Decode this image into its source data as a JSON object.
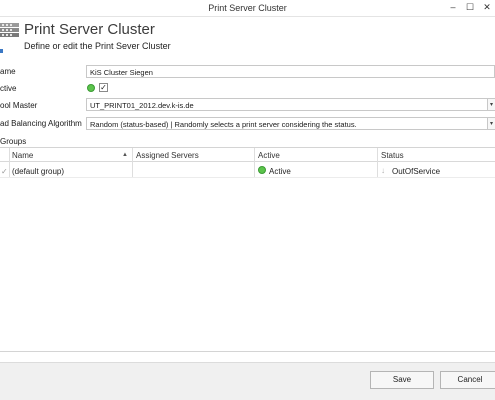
{
  "window": {
    "title": "Print Server Cluster",
    "minimize_glyph": "–",
    "maximize_glyph": "☐",
    "close_glyph": "✕"
  },
  "header": {
    "title": "Print Server Cluster",
    "subtitle": "Define or edit the Print Sever Cluster",
    "icon": "server-cluster-icon"
  },
  "form": {
    "name_label": "ame",
    "name_value": "KiS Cluster Siegen",
    "active_label": "ctive",
    "active_checked": "✓",
    "pool_master_label": "ool Master",
    "pool_master_value": "UT_PRINT01_2012.dev.k-is.de",
    "load_balancing_label": "ad Balancing Algorithm",
    "load_balancing_value": "Random (status-based) | Randomly selects a print server considering the status.",
    "dropdown_glyph": "▾"
  },
  "groups": {
    "section_label": "Groups",
    "columns": [
      "Name",
      "Assigned Servers",
      "Active",
      "Status"
    ],
    "sort_glyph": "▲",
    "rows": [
      {
        "name": "(default group)",
        "assigned_servers": "",
        "active": "Active",
        "status": "OutOfService"
      }
    ],
    "row_check_glyph": "✓",
    "status_arrow_glyph": "↓"
  },
  "footer": {
    "save_label": "Save",
    "cancel_label": "Cancel"
  },
  "colors": {
    "active_green": "#5cc44c",
    "accent_blue": "#3b78c4"
  }
}
